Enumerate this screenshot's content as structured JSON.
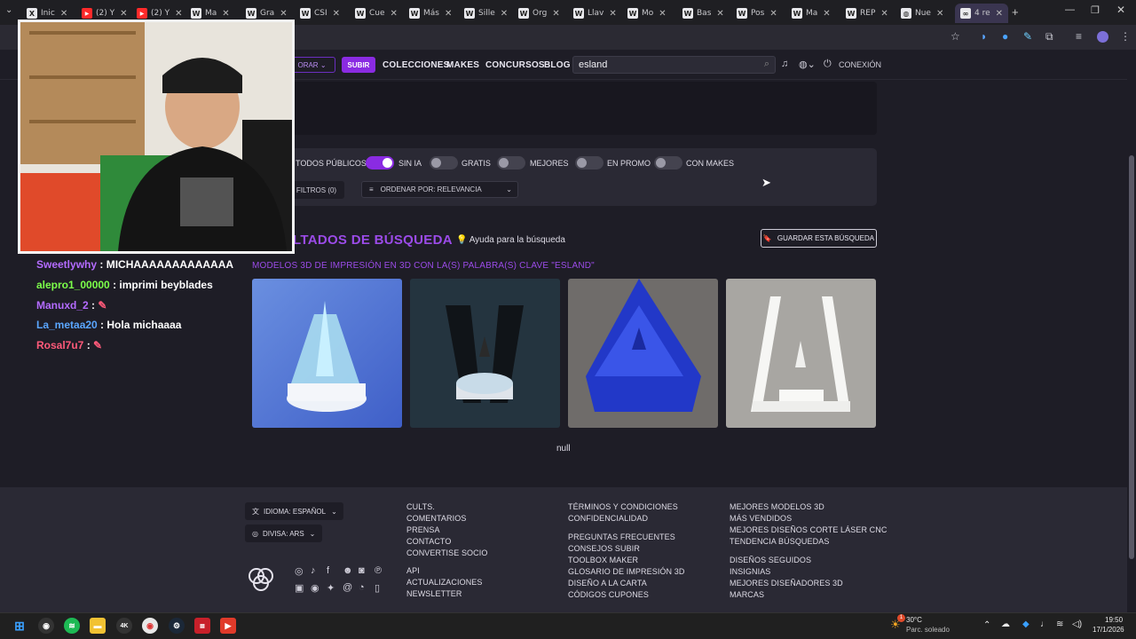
{
  "browser": {
    "tabs": [
      {
        "label": "Inic",
        "icon": "x-icon"
      },
      {
        "label": "(2) Y",
        "icon": "youtube-icon"
      },
      {
        "label": "(2) Y",
        "icon": "youtube-icon"
      },
      {
        "label": "Ma",
        "icon": "w-icon"
      },
      {
        "label": "Gra",
        "icon": "w-icon"
      },
      {
        "label": "CSI",
        "icon": "w-icon"
      },
      {
        "label": "Cue",
        "icon": "w-icon"
      },
      {
        "label": "Más",
        "icon": "w-icon"
      },
      {
        "label": "Sille",
        "icon": "w-icon"
      },
      {
        "label": "Org",
        "icon": "w-icon"
      },
      {
        "label": "Llav",
        "icon": "w-icon"
      },
      {
        "label": "Mo",
        "icon": "w-icon"
      },
      {
        "label": "Bas",
        "icon": "w-icon"
      },
      {
        "label": "Pos",
        "icon": "w-icon"
      },
      {
        "label": "Ma",
        "icon": "w-icon"
      },
      {
        "label": "REP",
        "icon": "w-icon"
      },
      {
        "label": "Nue",
        "icon": "globe-icon"
      },
      {
        "label": "4 re",
        "icon": "cults-icon",
        "active": true
      }
    ]
  },
  "nav": {
    "explore": "ORAR",
    "upload": "SUBIR",
    "collections": "COLECCIONES",
    "makes": "MAKES",
    "contests": "CONCURSOS",
    "blog": "BLOG",
    "search_value": "esland",
    "login": "CONEXIÓN"
  },
  "filters": {
    "toggles": [
      {
        "label": "TODOS PÚBLICOS",
        "on": false
      },
      {
        "label": "SIN IA",
        "on": true
      },
      {
        "label": "GRATIS",
        "on": false
      },
      {
        "label": "MEJORES",
        "on": false
      },
      {
        "label": "EN PROMO",
        "on": false
      },
      {
        "label": "CON MAKES",
        "on": false
      }
    ],
    "filters_button": "FILTROS",
    "filters_count": "(0)",
    "sort_label": "ORDENAR POR: RELEVANCIA"
  },
  "results": {
    "title": "LTADOS DE BÚSQUEDA",
    "help": "Ayuda para la búsqueda",
    "save": "GUARDAR ESTA BÚSQUEDA",
    "subtitle": "MODELOS 3D DE IMPRESIÓN EN 3D CON LA(S) PALABRA(S) CLAVE \"ESLAND\"",
    "null_text": "null"
  },
  "chat": [
    {
      "user": "Sweetlywhy",
      "msg": "MICHAAAAAAAAAAAAA",
      "color": "#b46bff"
    },
    {
      "user": "alepro1_00000",
      "msg": "imprimi beyblades",
      "color": "#7cff4a"
    },
    {
      "user": "Manuxd_2",
      "msg": "",
      "color": "#b46bff"
    },
    {
      "user": "La_metaa20",
      "msg": "Hola michaaaa",
      "color": "#5aa6ff"
    },
    {
      "user": "Rosal7u7",
      "msg": "",
      "color": "#ff5a7a"
    }
  ],
  "footer": {
    "language": "IDIOMA: ESPAÑOL",
    "currency": "DIVISA: ARS",
    "col1": [
      "CULTS.",
      "COMENTARIOS",
      "PRENSA",
      "CONTACTO",
      "CONVERTISE SOCIO",
      "API",
      "ACTUALIZACIONES",
      "NEWSLETTER"
    ],
    "col2a": [
      "TÉRMINOS Y CONDICIONES",
      "CONFIDENCIALIDAD"
    ],
    "col2b": [
      "PREGUNTAS FRECUENTES",
      "CONSEJOS SUBIR",
      "TOOLBOX MAKER",
      "GLOSARIO DE IMPRESIÓN 3D",
      "DISEÑO A LA CARTA",
      "CÓDIGOS CUPONES"
    ],
    "col3a": [
      "MEJORES MODELOS 3D",
      "MÁS VENDIDOS",
      "MEJORES DISEÑOS CORTE LÁSER CNC",
      "TENDENCIA BÚSQUEDAS"
    ],
    "col3b": [
      "DISEÑOS SEGUIDOS",
      "INSIGNIAS",
      "MEJORES DISEÑADORES 3D",
      "MARCAS"
    ]
  },
  "taskbar": {
    "weather_temp": "30°C",
    "weather_desc": "Parc. soleado",
    "time": "19:50",
    "date": "17/1/2026",
    "notif_count": "1"
  },
  "colors": {
    "accent": "#8a2be2",
    "accent_text": "#9b4be8",
    "bg": "#1e1d26",
    "panel": "#2a2934"
  }
}
